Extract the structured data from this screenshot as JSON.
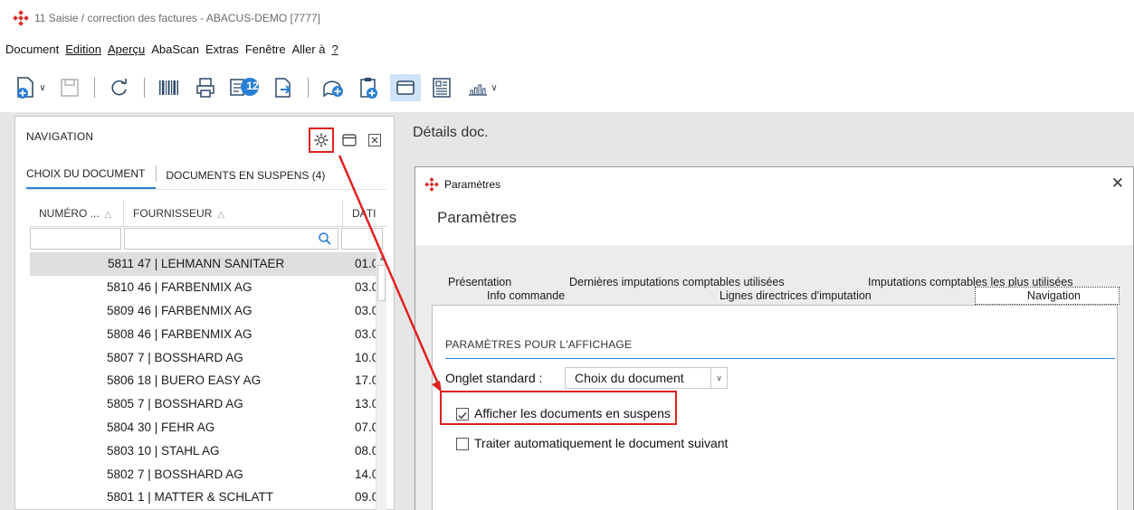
{
  "window": {
    "title": "11 Saisie / correction des factures - ABACUS-DEMO [7777]"
  },
  "menu": [
    "Document",
    "Edition",
    "Aperçu",
    "AbaScan",
    "Extras",
    "Fenêtre",
    "Aller à",
    "?"
  ],
  "toolbar": {
    "badge": "12"
  },
  "navigation": {
    "title": "NAVIGATION",
    "tabs": [
      "CHOIX DU DOCUMENT",
      "DOCUMENTS EN SUSPENS (4)"
    ],
    "columns": [
      "NUMÉRO ...",
      "FOURNISSEUR",
      "DATI"
    ],
    "rows": [
      {
        "num": "5811",
        "supplier": "47 | LEHMANN SANITAER",
        "date": "01.0"
      },
      {
        "num": "5810",
        "supplier": "46 | FARBENMIX AG",
        "date": "03.0"
      },
      {
        "num": "5809",
        "supplier": "46 | FARBENMIX AG",
        "date": "03.0"
      },
      {
        "num": "5808",
        "supplier": "46 | FARBENMIX AG",
        "date": "03.0"
      },
      {
        "num": "5807",
        "supplier": "7 | BOSSHARD AG",
        "date": "10.0"
      },
      {
        "num": "5806",
        "supplier": "18 | BUERO EASY AG",
        "date": "17.0"
      },
      {
        "num": "5805",
        "supplier": "7 | BOSSHARD AG",
        "date": "13.0"
      },
      {
        "num": "5804",
        "supplier": "30 | FEHR AG",
        "date": "07.0"
      },
      {
        "num": "5803",
        "supplier": "10 | STAHL AG",
        "date": "08.0"
      },
      {
        "num": "5802",
        "supplier": "7 | BOSSHARD AG",
        "date": "14.0"
      },
      {
        "num": "5801",
        "supplier": "1 | MATTER & SCHLATT",
        "date": "09.0"
      }
    ]
  },
  "details": {
    "title": "Détails doc."
  },
  "dialog": {
    "title": "Paramètres",
    "heading": "Paramètres",
    "tabs_row1": [
      "Présentation",
      "Dernières imputations comptables utilisées",
      "Imputations comptables les plus utilisées"
    ],
    "tabs_row2": [
      "Info commande",
      "Lignes directrices d'imputation",
      "Navigation"
    ],
    "section_title": "PARAMÈTRES POUR L'AFFICHAGE",
    "default_tab_label": "Onglet standard :",
    "default_tab_value": "Choix du document",
    "checkbox1": {
      "label": "Afficher les documents en suspens",
      "checked": true
    },
    "checkbox2": {
      "label": "Traiter automatiquement le document suivant",
      "checked": false
    }
  },
  "colors": {
    "accent": "#2a7fd4",
    "highlight": "#e02020",
    "brand": "#d9302a"
  }
}
